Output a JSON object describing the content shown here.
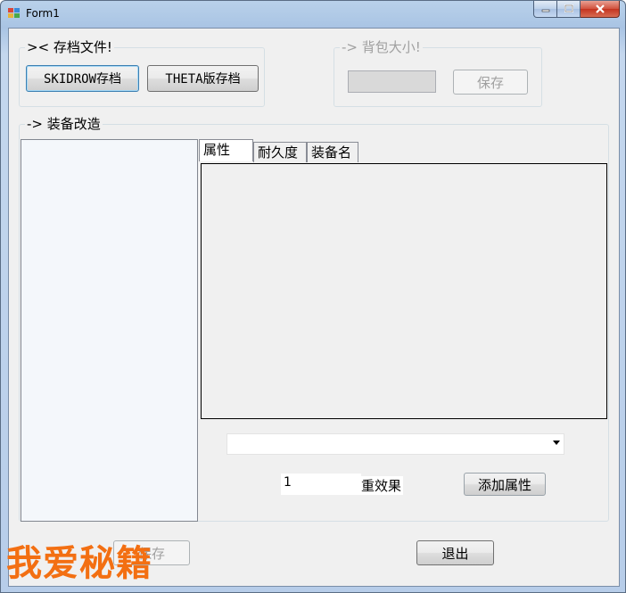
{
  "window": {
    "title": "Form1",
    "icon": "form-icon"
  },
  "save_file_group": {
    "legend": ">< 存档文件!",
    "skidrow_button": "SKIDROW存档",
    "theta_button": "THETA版存档"
  },
  "bag_group": {
    "legend": "-> 背包大小!",
    "size_value": "",
    "save_button": "保存"
  },
  "equip_group": {
    "legend": "-> 装备改造",
    "tabs": [
      {
        "label": "属性",
        "active": true
      },
      {
        "label": "耐久度",
        "active": false
      },
      {
        "label": "装备名",
        "active": false
      }
    ],
    "attribute_select": "",
    "count_value": "1",
    "count_suffix": "重效果",
    "add_button": "添加属性"
  },
  "bottom": {
    "save_button": "保存",
    "exit_button": "退出"
  },
  "watermark": "我爱秘籍",
  "colors": {
    "watermark": "#f36f12",
    "close_button": "#c43420",
    "client_bg": "#f0f0f0"
  }
}
